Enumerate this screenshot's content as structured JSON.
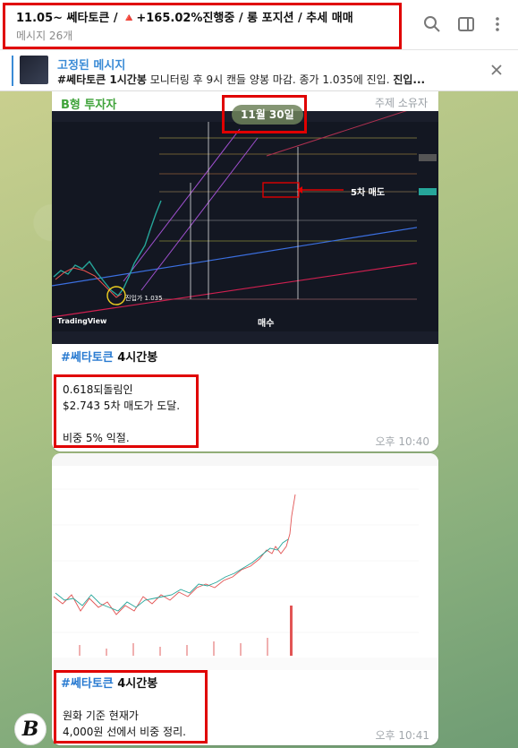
{
  "header": {
    "title": "11.05~ 쎄타토큰 / 🔺+165.02%진행중 / 롱 포지션 / 추세 매매",
    "subtitle": "메시지 26개"
  },
  "pinned": {
    "label": "고정된 메시지",
    "text_bold": "#쎄타토큰 1시간봉",
    "text_rest": " 모니터링 후 9시 캔들 양봉 마감. 종가 1.035에 진입. ",
    "text_tail": "진입..."
  },
  "messages": [
    {
      "sender": "B형 투자자",
      "admin_tag": "주제 소유자",
      "date_pill": "11월 30일",
      "chart_annotations": {
        "sell_label": "5차 매도",
        "entry_label": "진입가 1.035",
        "buy_label": "매수",
        "watermark": "TradingView"
      },
      "hashtag": "#쎄타토큰",
      "hashtag_rest": " 4시간봉",
      "lines": [
        "0.618되돌림인",
        "$2.743 5차 매도가 도달.",
        "",
        "비중 5% 익절."
      ],
      "time": "오후 10:40"
    },
    {
      "hashtag": "#쎄타토큰",
      "hashtag_rest": " 4시간봉",
      "lines": [
        "원화 기준 현재가",
        "4,000원 선에서 비중 정리."
      ],
      "time": "오후 10:41"
    }
  ],
  "avatar_letter": "B",
  "colors": {
    "accent": "#3a8bd6",
    "sender": "#3fa33a",
    "highlight_box": "#e00000",
    "hashtag": "#2a7bd1"
  }
}
